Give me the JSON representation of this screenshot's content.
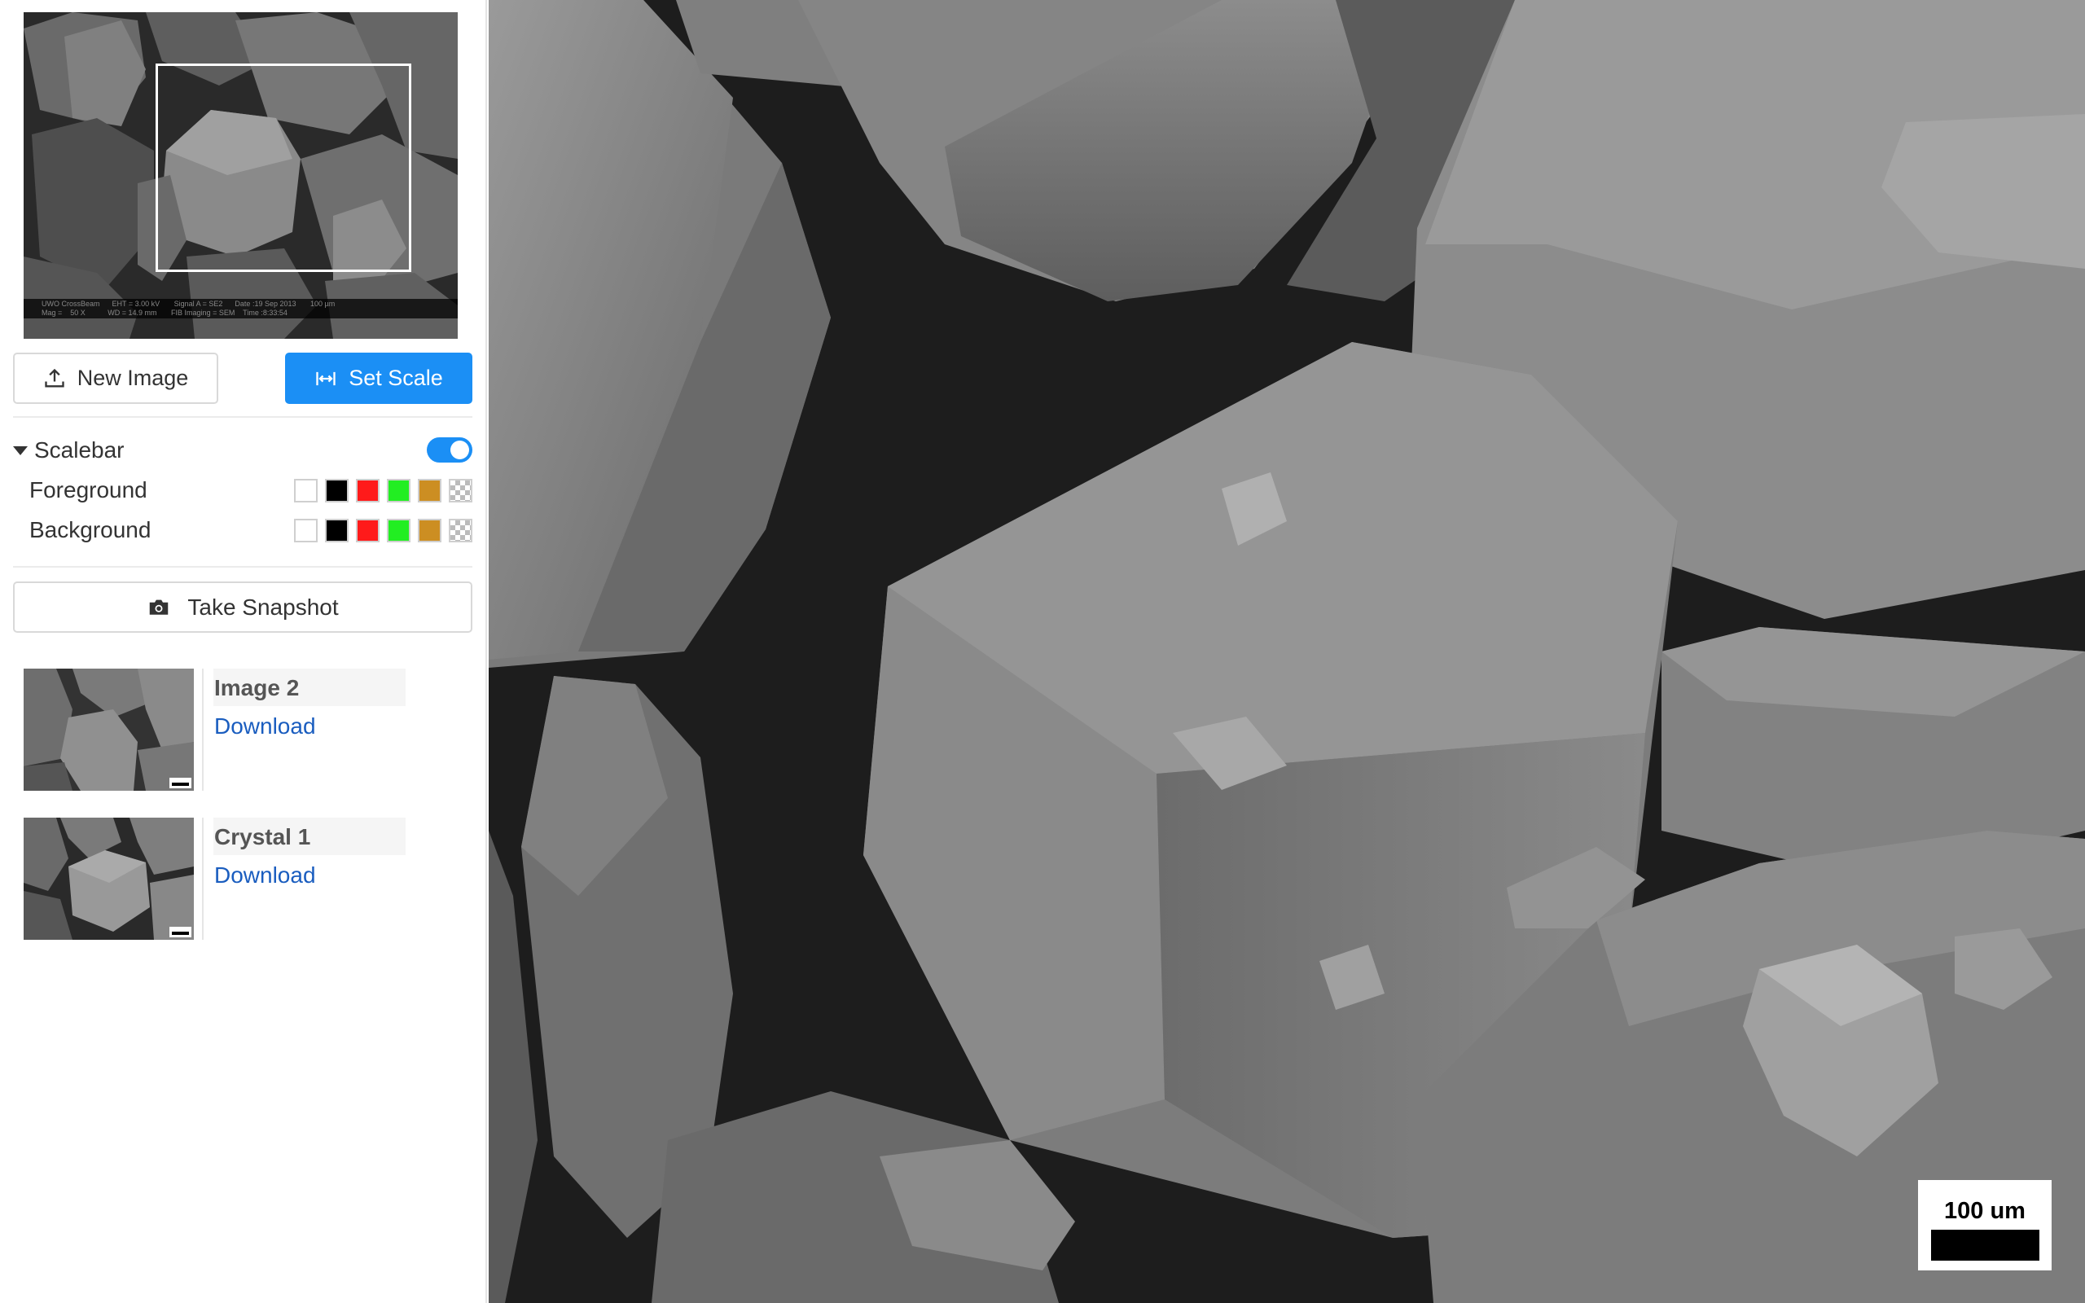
{
  "sidebar": {
    "overview": {
      "info_line_1": "UWO CrossBeam      EHT = 3.00 kV       Signal A = SE2      Date :19 Sep 2013       100 µm",
      "info_line_2": "Mag =    50 X           WD = 14.9 mm       FIB Imaging = SEM    Time :8:33:54"
    },
    "buttons": {
      "new_image": "New Image",
      "set_scale": "Set Scale",
      "take_snapshot": "Take Snapshot"
    },
    "scalebar": {
      "label": "Scalebar",
      "enabled": true,
      "foreground_label": "Foreground",
      "background_label": "Background",
      "swatch_colors": [
        "#ffffff",
        "#000000",
        "#ff1a1a",
        "#22ee22",
        "#cc8e22",
        "transparent"
      ]
    },
    "snapshots": [
      {
        "name": "Image 2",
        "download": "Download"
      },
      {
        "name": "Crystal 1",
        "download": "Download"
      }
    ]
  },
  "main": {
    "scalebar_text": "100 um"
  },
  "colors": {
    "accent": "#1b8ff5",
    "link": "#1a5dbf"
  }
}
